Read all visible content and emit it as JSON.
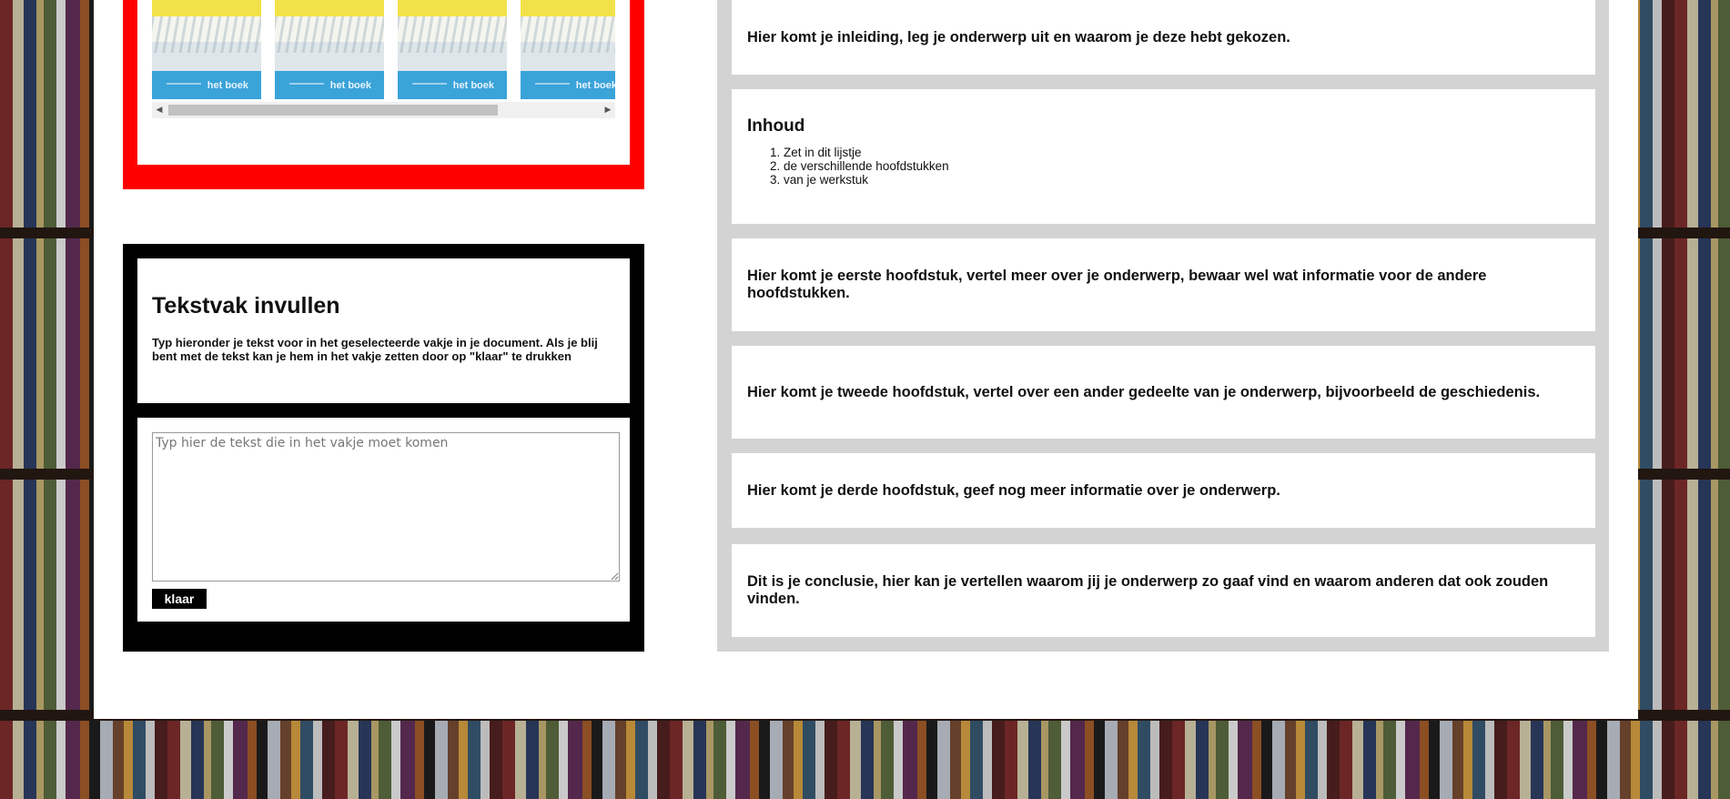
{
  "book_gallery": {
    "books": [
      {
        "title": "het boek"
      },
      {
        "title": "het boek"
      },
      {
        "title": "het boek"
      },
      {
        "title": "het boek"
      }
    ]
  },
  "textbox_panel": {
    "heading": "Tekstvak invullen",
    "instructions": "Typ hieronder je tekst voor in het geselecteerde vakje in je document. Als je blij bent met de tekst kan je hem in het vakje zetten door op \"klaar\" te drukken",
    "textarea_placeholder": "Typ hier de tekst die in het vakje moet komen",
    "textarea_value": "",
    "done_label": "klaar"
  },
  "document": {
    "intro": "Hier komt je inleiding, leg je onderwerp uit en waarom je deze hebt gekozen.",
    "toc_heading": "Inhoud",
    "toc_items": [
      "Zet in dit lijstje",
      "de verschillende hoofdstukken",
      "van je werkstuk"
    ],
    "chapter1": "Hier komt je eerste hoofdstuk, vertel meer over je onderwerp, bewaar wel wat informatie voor de andere hoofdstukken.",
    "chapter2": "Hier komt je tweede hoofdstuk, vertel over een ander gedeelte van je onderwerp, bijvoorbeeld de geschiedenis.",
    "chapter3": "Hier komt je derde hoofdstuk, geef nog meer informatie over je onderwerp.",
    "conclusion": "Dit is je conclusie, hier kan je vertellen waarom jij je onderwerp zo gaaf vind en waarom anderen dat ook zouden vinden."
  },
  "colors": {
    "gallery_border": "#ff0000",
    "form_border": "#000000",
    "document_frame": "#d3d3d3"
  }
}
